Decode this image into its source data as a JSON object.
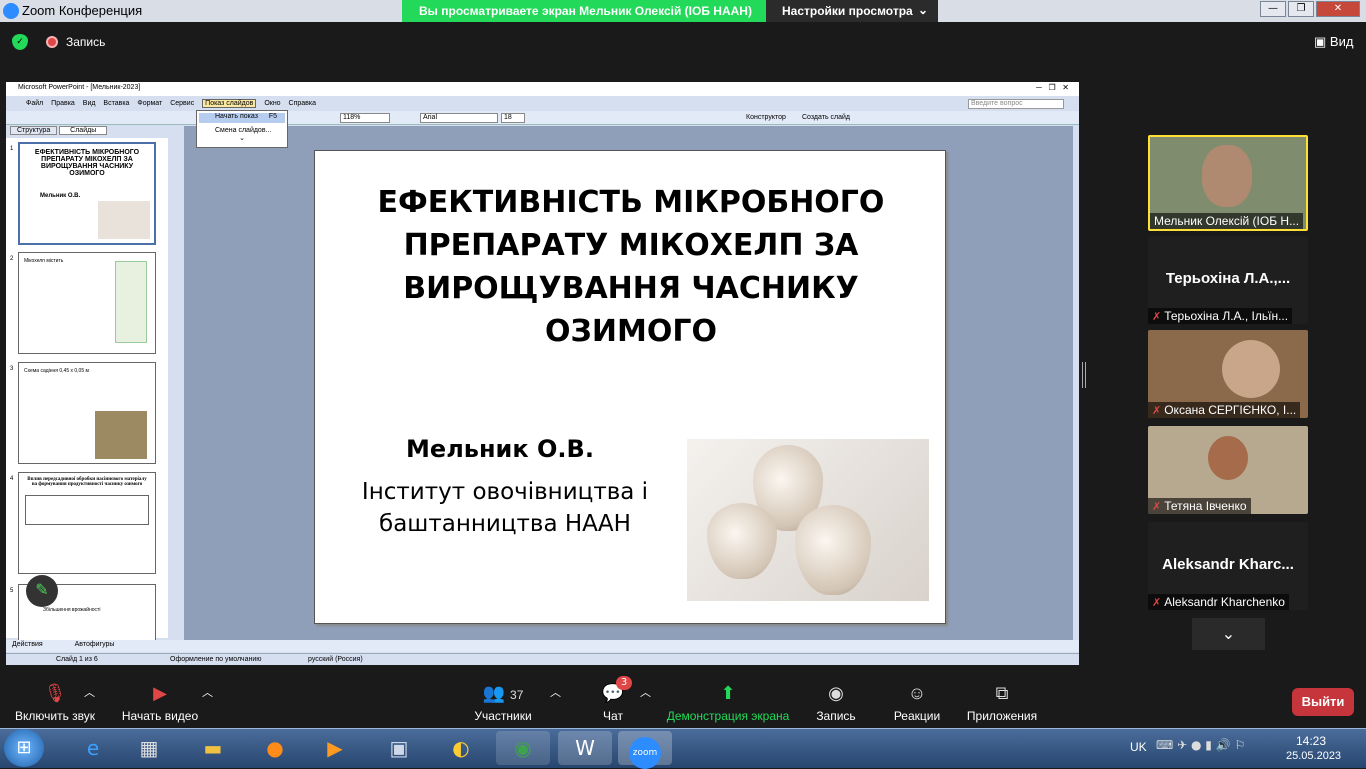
{
  "window": {
    "title": "Zoom Конференция",
    "share_banner": "Вы просматриваете экран Мельник Олексій (ІОБ НААН)",
    "view_options": "Настройки просмотра",
    "min": "—",
    "max": "❐",
    "close": "✕"
  },
  "zoom_top": {
    "record_label": "Запись",
    "view_label": "Вид"
  },
  "ppt": {
    "title": "Microsoft PowerPoint - [Мельник-2023]",
    "menu": [
      "Файл",
      "Правка",
      "Вид",
      "Вставка",
      "Формат",
      "Сервис",
      "Показ слайдов",
      "Окно",
      "Справка"
    ],
    "help_placeholder": "Введите вопрос",
    "dropdown": {
      "item1": "Начать показ",
      "item1_key": "F5",
      "item2": "Смена слайдов..."
    },
    "zoom": "118%",
    "font": "Arial",
    "size": "18",
    "designer": "Конструктор",
    "new_slide": "Создать слайд",
    "tabs": [
      "Структура",
      "Слайды"
    ],
    "slide": {
      "title": "ЕФЕКТИВНІСТЬ МІКРОБНОГО ПРЕПАРАТУ МІКОХЕЛП ЗА ВИРОЩУВАННЯ ЧАСНИКУ ОЗИМОГО",
      "author": "Мельник О.В.",
      "institute": "Інститут овочівництва і баштанництва НААН"
    },
    "thumbs": [
      {
        "num": "1",
        "text": "ЕФЕКТИВНІСТЬ МІКРОБНОГО ПРЕПАРАТУ МІКОХЕЛП ЗА ВИРОЩУВАННЯ ЧАСНИКУ ОЗИМОГО",
        "sub": "Мельник О.В."
      },
      {
        "num": "2",
        "text": "Мікохелп містить"
      },
      {
        "num": "3",
        "text": "Схема садіння 0,45 х 0,05 м"
      },
      {
        "num": "4",
        "text": "Вплив передсадивної обробки насіннєвого матеріалу на формування продуктивності часнику озимого"
      },
      {
        "num": "5",
        "text": "Збільшення врожайності"
      }
    ],
    "status": {
      "slide": "Слайд 1 из 6",
      "design": "Оформление по умолчанию",
      "lang": "русский (Россия)"
    },
    "draw_actions": "Действия",
    "autoshapes": "Автофигуры"
  },
  "participants": [
    {
      "name": "Мельник Олексій (ІОБ Н...",
      "video": true
    },
    {
      "name": "Терьохіна Л.А., Ільїн...",
      "big": "Терьохіна Л.А.,...",
      "video": false
    },
    {
      "name": "Оксана СЕРГІЄНКО, І...",
      "video": true
    },
    {
      "name": "Тетяна Івченко",
      "video": true
    },
    {
      "name": "Aleksandr Kharchenko",
      "big": "Aleksandr  Kharc...",
      "video": false
    }
  ],
  "toolbar": {
    "mute": "Включить звук",
    "video": "Начать видео",
    "participants": "Участники",
    "participants_count": "37",
    "chat": "Чат",
    "chat_badge": "3",
    "share": "Демонстрация экрана",
    "record": "Запись",
    "reactions": "Реакции",
    "apps": "Приложения",
    "leave": "Выйти"
  },
  "tray": {
    "lang": "UK",
    "time": "14:23",
    "date": "25.05.2023",
    "zoom_label": "zoom"
  }
}
